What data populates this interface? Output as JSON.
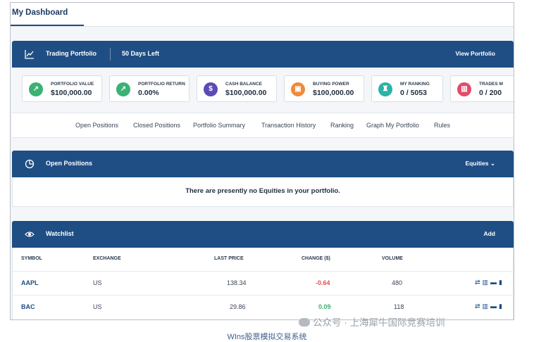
{
  "dashboard": {
    "title": "My Dashboard"
  },
  "portfolio_bar": {
    "title": "Trading Portfolio",
    "days_left": "50 Days Left",
    "view_link": "View Portfolio"
  },
  "cards": [
    {
      "label": "PORTFOLIO VALUE",
      "value": "$100,000.00",
      "color": "#3bb273",
      "icon": "arrow-up-right-icon"
    },
    {
      "label": "PORTFOLIO RETURN",
      "value": "0.00%",
      "color": "#3bb273",
      "icon": "arrow-up-right-icon"
    },
    {
      "label": "CASH BALANCE",
      "value": "$100,000.00",
      "color": "#5b4bb5",
      "icon": "dollar-icon"
    },
    {
      "label": "BUYING POWER",
      "value": "$100,000.00",
      "color": "#f08a3c",
      "icon": "wallet-icon"
    },
    {
      "label": "MY RANKING",
      "value": "0 / 5053",
      "color": "#2bb3a8",
      "icon": "trophy-icon"
    },
    {
      "label": "TRADES M",
      "value": "0 / 200",
      "color": "#e14b6a",
      "icon": "bar-chart-icon"
    }
  ],
  "tabs": [
    "Open Positions",
    "Closed Positions",
    "Portfolio Summary",
    "Transaction History",
    "Ranking",
    "Graph My Portfolio",
    "Rules"
  ],
  "open_positions": {
    "title": "Open Positions",
    "filter": "Equities",
    "empty_message": "There are presently no Equities in your portfolio."
  },
  "watchlist": {
    "title": "Watchlist",
    "add_label": "Add",
    "columns": [
      "SYMBOL",
      "EXCHANGE",
      "LAST PRICE",
      "CHANGE ($)",
      "VOLUME"
    ],
    "rows": [
      {
        "symbol": "AAPL",
        "exchange": "US",
        "last_price": "138.34",
        "change": "-0.64",
        "volume": "480"
      },
      {
        "symbol": "BAC",
        "exchange": "US",
        "last_price": "29.86",
        "change": "0.09",
        "volume": "118"
      }
    ]
  },
  "caption": "WIns股票模拟交易系统",
  "source_label": "公众号 · 上海犀牛国际竞赛培训",
  "colors": {
    "bar": "#1f4e84",
    "negative": "#d9534f",
    "positive": "#3bb273"
  }
}
